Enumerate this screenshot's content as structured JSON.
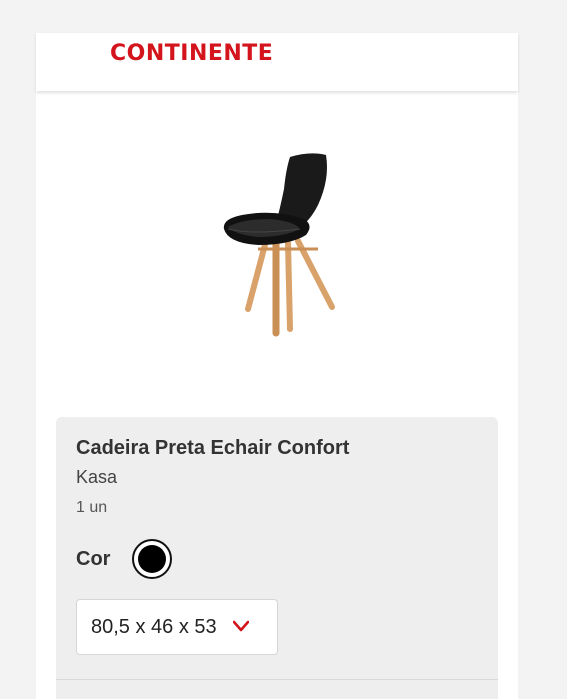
{
  "header": {
    "logo_text": "CONTINENTE",
    "logo_color": "#d3141d"
  },
  "product": {
    "image_alt": "chair-image",
    "title": "Cadeira Preta Echair Confort",
    "brand": "Kasa",
    "unit": "1 un",
    "color_label": "Cor",
    "selected_color": "#000000",
    "size": {
      "selected": "80,5 x 46 x 53",
      "icon": "chevron-down-icon"
    }
  }
}
